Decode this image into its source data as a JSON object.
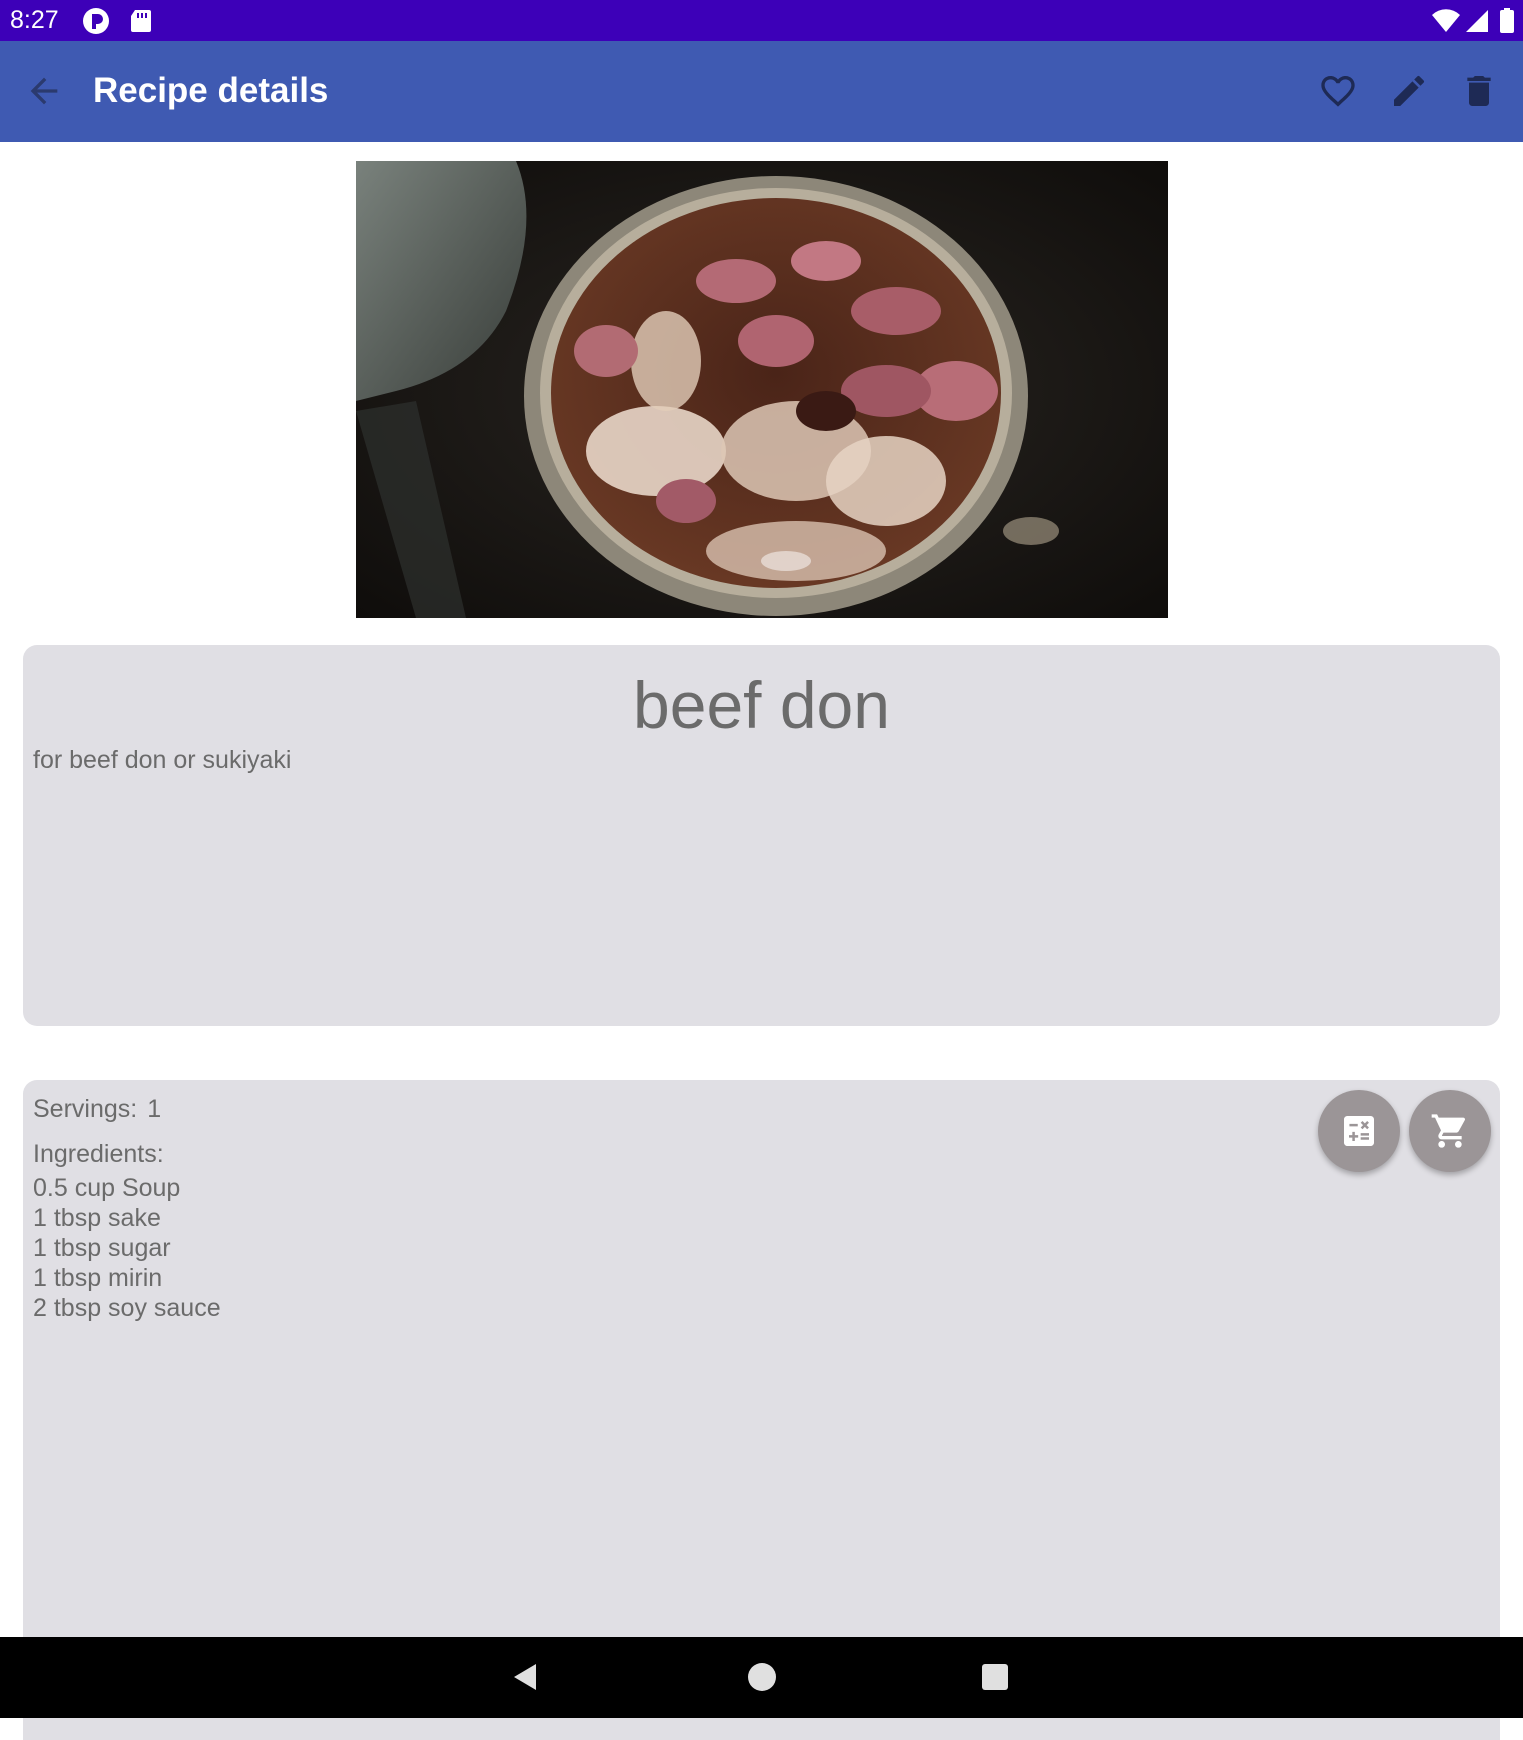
{
  "status_bar": {
    "time": "8:27",
    "left_icons": [
      "app-notification-icon",
      "sd-card-icon"
    ],
    "right_icons": [
      "wifi-icon",
      "signal-icon",
      "battery-icon"
    ],
    "color": "#3d00b8"
  },
  "app_bar": {
    "title": "Recipe details",
    "color": "#3f5ab2",
    "navigation_icon": "arrow-back-icon",
    "actions": [
      "heart-icon",
      "pencil-icon",
      "trash-icon"
    ]
  },
  "recipe": {
    "name": "beef don",
    "description": "for beef don or sukiyaki",
    "servings_label": "Servings:",
    "servings_value": "1",
    "ingredients_label": "Ingredients:",
    "ingredients": [
      "0.5 cup Soup",
      "1 tbsp sake",
      "1 tbsp sugar",
      "1 tbsp mirin",
      "2 tbsp soy sauce"
    ]
  },
  "card_actions": [
    "calculator-icon",
    "shopping-cart-icon"
  ],
  "nav_bar": {
    "buttons": [
      "nav-back-icon",
      "nav-home-icon",
      "nav-recents-icon"
    ]
  }
}
